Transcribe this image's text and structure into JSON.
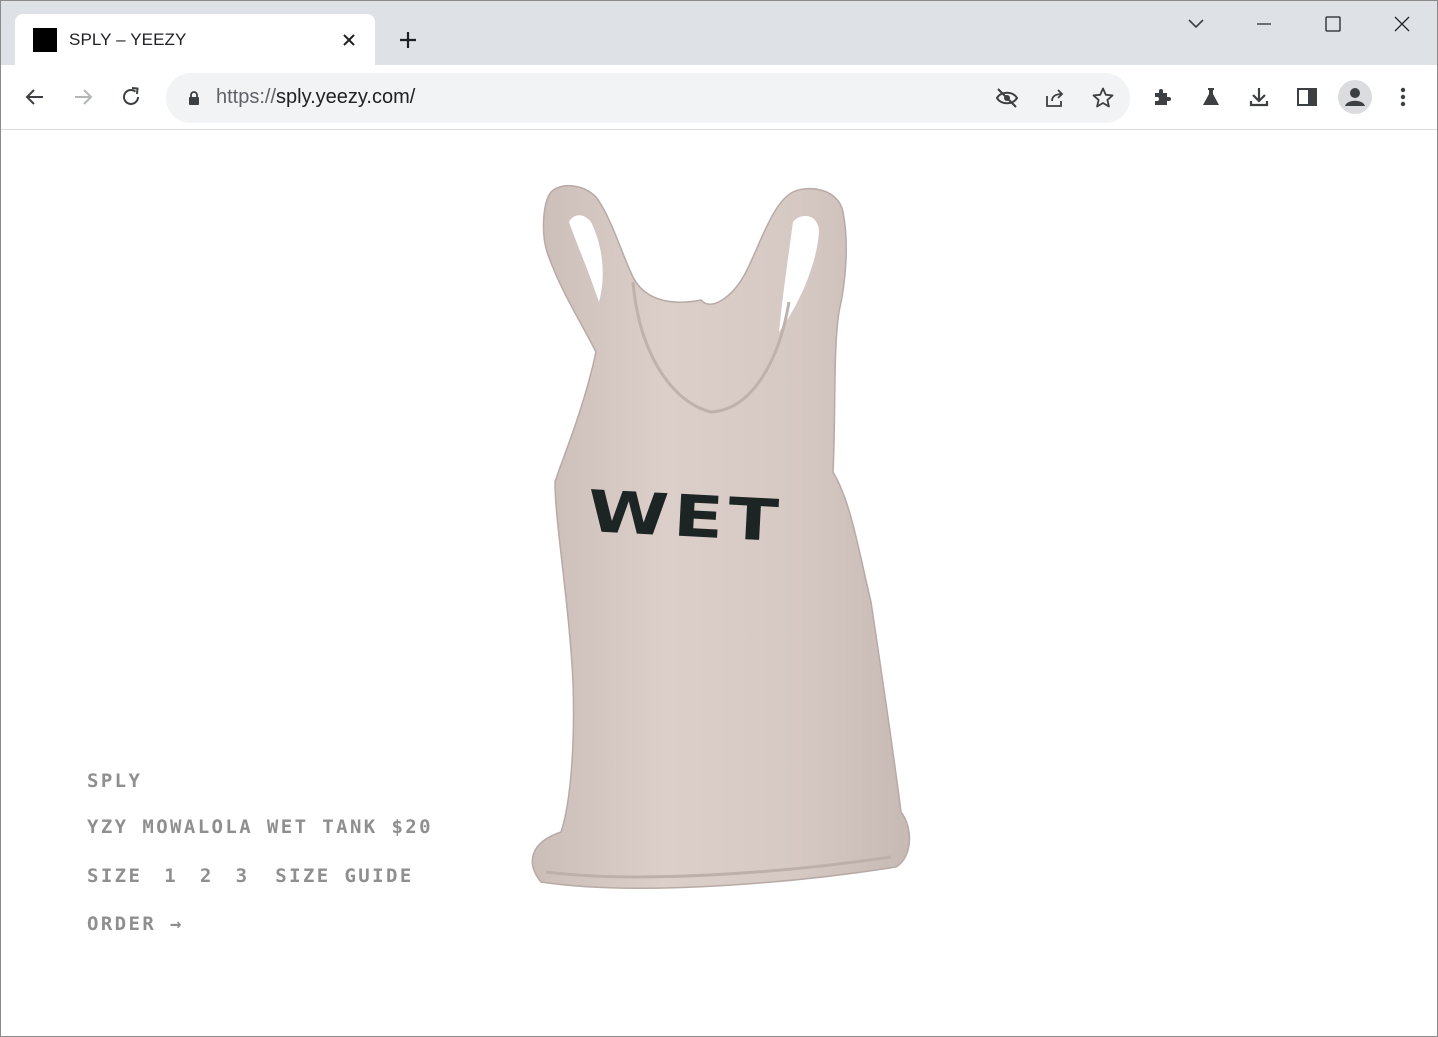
{
  "browser": {
    "tab": {
      "title": "SPLY – YEEZY",
      "favicon": "black-square-icon"
    },
    "new_tab_icon": "plus-icon",
    "window_controls": [
      "tab-search-icon",
      "minimize-icon",
      "maximize-icon",
      "close-icon"
    ],
    "omnibox": {
      "url_scheme": "https://",
      "url_rest": "sply.yeezy.com/",
      "icons": [
        "lock-icon",
        "eye-off-icon",
        "share-icon",
        "star-icon"
      ]
    },
    "toolbar_icons": [
      "back-icon",
      "forward-icon",
      "reload-icon",
      "extensions-icon",
      "labs-icon",
      "download-icon",
      "side-panel-icon",
      "profile-icon",
      "menu-icon"
    ]
  },
  "page": {
    "brand": "SPLY",
    "product_line": "YZY MOWALOLA WET TANK $20",
    "size_label": "SIZE",
    "sizes": [
      "1",
      "2",
      "3"
    ],
    "size_guide": "SIZE GUIDE",
    "order": "ORDER →",
    "product_graphic_text": "WET",
    "colors": {
      "tank": "#d8cbc6",
      "print": "#1c2524",
      "info_text": "#8f8f8f"
    }
  }
}
